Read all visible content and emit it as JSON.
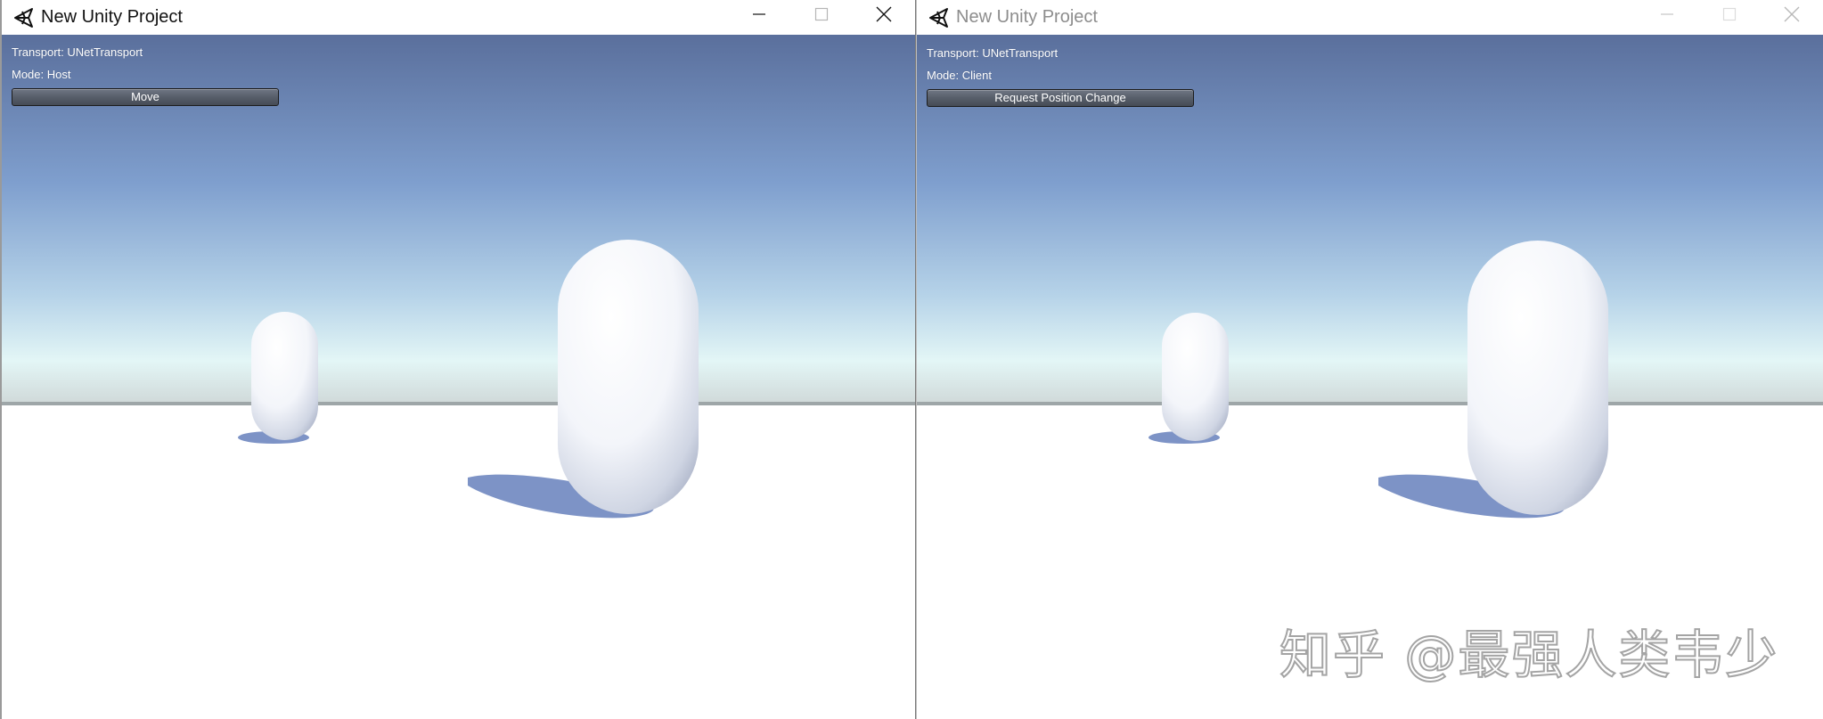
{
  "left_window": {
    "title": "New Unity Project",
    "active": true,
    "hud": {
      "transport": "Transport: UNetTransport",
      "mode": "Mode: Host",
      "button_label": "Move"
    }
  },
  "right_window": {
    "title": "New Unity Project",
    "active": false,
    "hud": {
      "transport": "Transport: UNetTransport",
      "mode": "Mode: Client",
      "button_label": "Request Position Change"
    }
  },
  "watermark": "知乎 @最强人类韦少",
  "icons": {
    "app": "unity-logo-icon",
    "minimize": "minimize-icon",
    "maximize": "maximize-icon",
    "close": "close-icon"
  },
  "colors": {
    "sky_top": "#5a6f9c",
    "sky_horizon": "#dff4f6",
    "ground": "#ffffff",
    "capsule_shadow": "#7d93c6",
    "button_bg": "#59606c"
  }
}
